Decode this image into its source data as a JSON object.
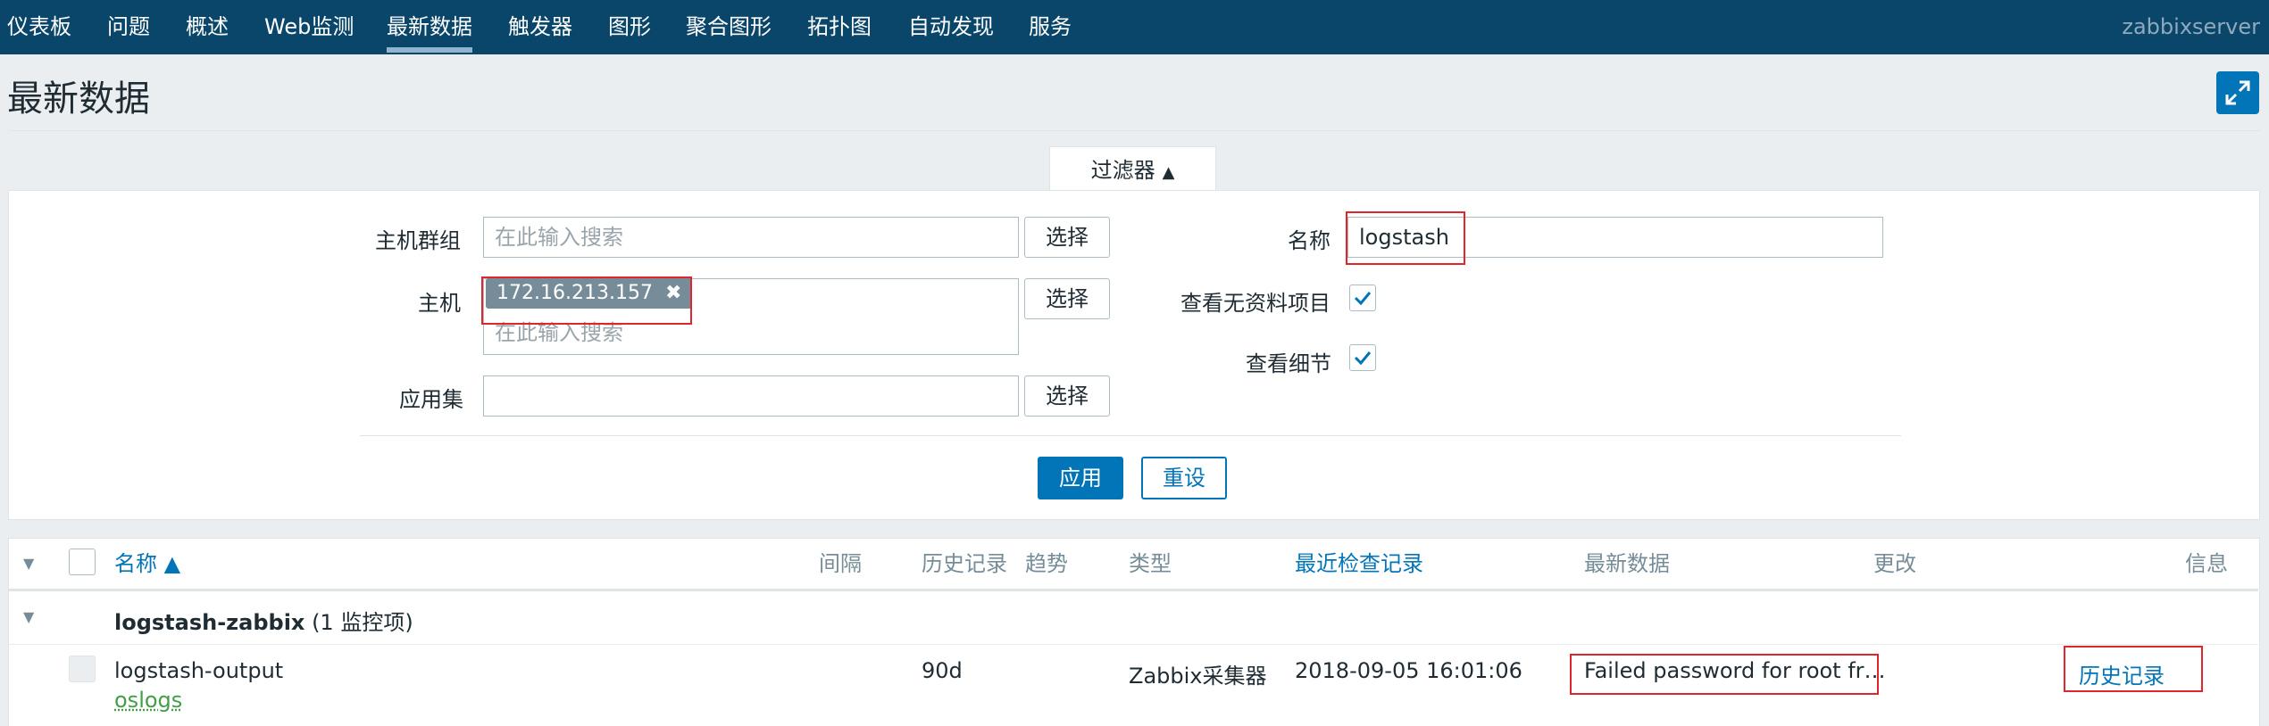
{
  "nav": {
    "items": [
      "仪表板",
      "问题",
      "概述",
      "Web监测",
      "最新数据",
      "触发器",
      "图形",
      "聚合图形",
      "拓扑图",
      "自动发现",
      "服务"
    ],
    "active": "最新数据",
    "server": "zabbixserver"
  },
  "page": {
    "title": "最新数据"
  },
  "filter": {
    "tab_label": "过滤器",
    "hostgroup_label": "主机群组",
    "hostgroup_placeholder": "在此输入搜索",
    "host_label": "主机",
    "host_chip": "172.16.213.157",
    "host_placeholder": "在此输入搜索",
    "application_label": "应用集",
    "select_label": "选择",
    "name_label": "名称",
    "name_value": "logstash",
    "show_no_data_label": "查看无资料项目",
    "show_no_data_checked": true,
    "show_details_label": "查看细节",
    "show_details_checked": true,
    "apply_label": "应用",
    "reset_label": "重设"
  },
  "table": {
    "headers": {
      "name": "名称 ▲",
      "interval": "间隔",
      "history": "历史记录",
      "trends": "趋势",
      "type": "类型",
      "last_check": "最近检查记录",
      "last_value": "最新数据",
      "change": "更改",
      "info": "信息"
    },
    "group": {
      "name": "logstash-zabbix",
      "count": "(1 监控项)"
    },
    "rows": [
      {
        "name": "logstash-output",
        "application": "oslogs",
        "history": "90d",
        "type": "Zabbix采集器",
        "last_check": "2018-09-05 16:01:06",
        "last_value": "Failed password for root fr…",
        "link": "历史记录"
      }
    ]
  },
  "colors": {
    "nav_bg": "#0a466a",
    "accent": "#0275b8",
    "highlight": "#e0252c",
    "app_green": "#429e47"
  }
}
